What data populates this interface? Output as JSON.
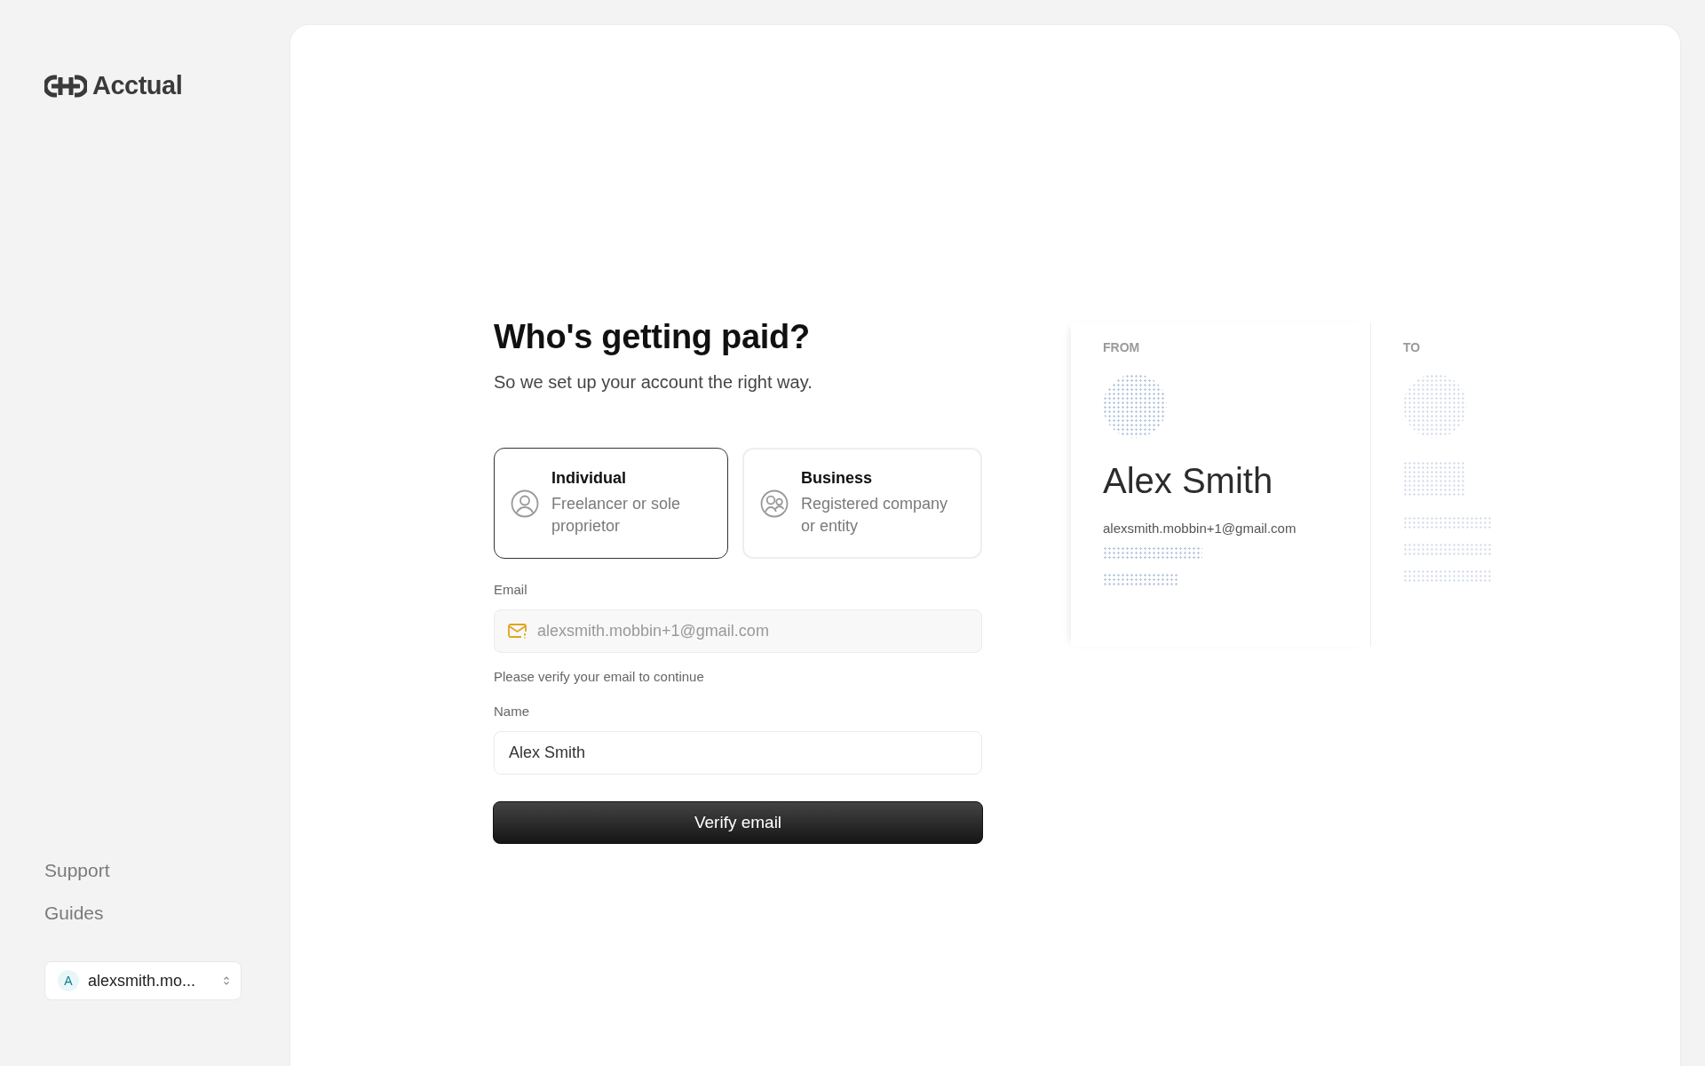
{
  "sidebar": {
    "logo": "Acctual",
    "links": [
      {
        "label": "Support"
      },
      {
        "label": "Guides"
      }
    ],
    "account": {
      "initial": "A",
      "label": "alexsmith.mo..."
    }
  },
  "form": {
    "title": "Who's getting paid?",
    "subtitle": "So we set up your account the right way.",
    "options": [
      {
        "kind": "person",
        "title": "Individual",
        "description": "Freelancer or sole proprietor",
        "selected": true
      },
      {
        "kind": "group",
        "title": "Business",
        "description": "Registered company or entity",
        "selected": false
      }
    ],
    "email": {
      "label": "Email",
      "value": "alexsmith.mobbin+1@gmail.com",
      "disabled": true,
      "hint": "Please verify your email to continue"
    },
    "name": {
      "label": "Name",
      "value": "Alex Smith",
      "disabled": false
    },
    "button": "Verify email"
  },
  "preview": {
    "from_label": "FROM",
    "name": "Alex Smith",
    "email": "alexsmith.mobbin+1@gmail.com",
    "to_label": "TO"
  }
}
